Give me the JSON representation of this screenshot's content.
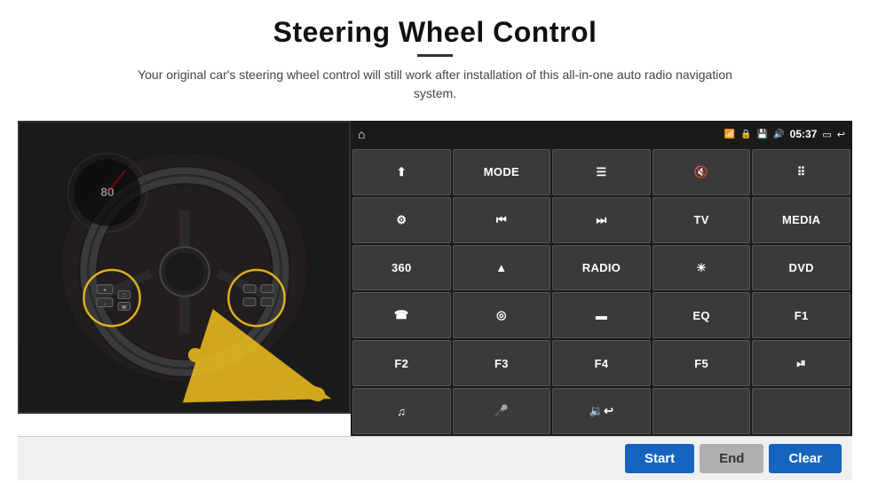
{
  "page": {
    "title": "Steering Wheel Control",
    "subtitle": "Your original car's steering wheel control will still work after installation of this all-in-one auto radio navigation system."
  },
  "status_bar": {
    "time": "05:37",
    "home_icon": "⌂",
    "wifi_icon": "wifi",
    "lock_icon": "🔒",
    "bt_icon": "bt",
    "vol_icon": "🔊",
    "screen_icon": "▭",
    "back_icon": "↩"
  },
  "buttons": [
    {
      "id": "r1c1",
      "label": "⬆",
      "type": "icon"
    },
    {
      "id": "r1c2",
      "label": "MODE",
      "type": "text"
    },
    {
      "id": "r1c3",
      "label": "≡",
      "type": "icon"
    },
    {
      "id": "r1c4",
      "label": "🔇",
      "type": "icon"
    },
    {
      "id": "r1c5",
      "label": "⠿",
      "type": "icon"
    },
    {
      "id": "r2c1",
      "label": "⚙",
      "type": "icon"
    },
    {
      "id": "r2c2",
      "label": "⏮",
      "type": "icon"
    },
    {
      "id": "r2c3",
      "label": "⏭",
      "type": "icon"
    },
    {
      "id": "r2c4",
      "label": "TV",
      "type": "text"
    },
    {
      "id": "r2c5",
      "label": "MEDIA",
      "type": "text"
    },
    {
      "id": "r3c1",
      "label": "360",
      "type": "text"
    },
    {
      "id": "r3c2",
      "label": "▲",
      "type": "icon"
    },
    {
      "id": "r3c3",
      "label": "RADIO",
      "type": "text"
    },
    {
      "id": "r3c4",
      "label": "☀",
      "type": "icon"
    },
    {
      "id": "r3c5",
      "label": "DVD",
      "type": "text"
    },
    {
      "id": "r4c1",
      "label": "📞",
      "type": "icon"
    },
    {
      "id": "r4c2",
      "label": "◎",
      "type": "icon"
    },
    {
      "id": "r4c3",
      "label": "—",
      "type": "icon"
    },
    {
      "id": "r4c4",
      "label": "EQ",
      "type": "text"
    },
    {
      "id": "r4c5",
      "label": "F1",
      "type": "text"
    },
    {
      "id": "r5c1",
      "label": "F2",
      "type": "text"
    },
    {
      "id": "r5c2",
      "label": "F3",
      "type": "text"
    },
    {
      "id": "r5c3",
      "label": "F4",
      "type": "text"
    },
    {
      "id": "r5c4",
      "label": "F5",
      "type": "text"
    },
    {
      "id": "r5c5",
      "label": "⏯",
      "type": "icon"
    },
    {
      "id": "r6c1",
      "label": "♫",
      "type": "icon"
    },
    {
      "id": "r6c2",
      "label": "🎤",
      "type": "icon"
    },
    {
      "id": "r6c3",
      "label": "🔉/↩",
      "type": "icon"
    },
    {
      "id": "r6c4",
      "label": "",
      "type": "empty"
    },
    {
      "id": "r6c5",
      "label": "",
      "type": "empty"
    }
  ],
  "footer": {
    "start_label": "Start",
    "end_label": "End",
    "clear_label": "Clear"
  }
}
